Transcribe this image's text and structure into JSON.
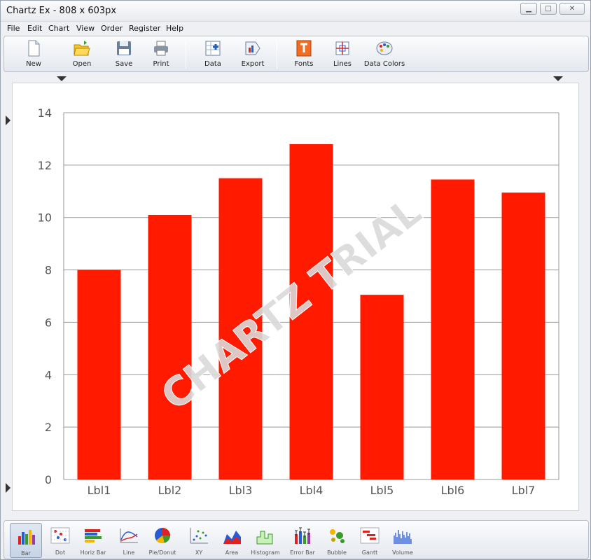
{
  "window": {
    "title": "Chartz Ex - 808 x 603px"
  },
  "menu": [
    "File",
    "Edit",
    "Chart",
    "View",
    "Order",
    "Register",
    "Help"
  ],
  "toolbar": [
    {
      "label": "New",
      "icon": "new-file-icon"
    },
    {
      "label": "Open",
      "icon": "open-folder-icon"
    },
    {
      "label": "Save",
      "icon": "floppy-disk-icon"
    },
    {
      "label": "Print",
      "icon": "printer-icon"
    },
    {
      "label": "Data",
      "icon": "data-table-icon"
    },
    {
      "label": "Export",
      "icon": "export-chart-icon"
    },
    {
      "label": "Fonts",
      "icon": "fonts-icon"
    },
    {
      "label": "Lines",
      "icon": "lines-icon"
    },
    {
      "label": "Data Colors",
      "icon": "palette-icon"
    }
  ],
  "watermark": "CHARTZ TRIAL",
  "colors": {
    "bar": "#ff1a00",
    "grid": "#999999",
    "watermark": "#d9d9d9"
  },
  "chart_data": {
    "type": "bar",
    "categories": [
      "Lbl1",
      "Lbl2",
      "Lbl3",
      "Lbl4",
      "Lbl5",
      "Lbl6",
      "Lbl7"
    ],
    "values": [
      8.0,
      10.1,
      11.5,
      12.8,
      7.05,
      11.45,
      10.95
    ],
    "ylim": [
      0,
      14
    ],
    "yticks": [
      0,
      2,
      4,
      6,
      8,
      10,
      12,
      14
    ],
    "grid": true,
    "title": "",
    "xlabel": "",
    "ylabel": ""
  },
  "chart_types": [
    {
      "label": "Bar",
      "icon": "bar-chart-icon",
      "selected": true
    },
    {
      "label": "Dot",
      "icon": "dot-chart-icon"
    },
    {
      "label": "Horiz Bar",
      "icon": "horizontal-bar-chart-icon"
    },
    {
      "label": "Line",
      "icon": "line-chart-icon"
    },
    {
      "label": "Pie/Donut",
      "icon": "pie-chart-icon"
    },
    {
      "label": "XY",
      "icon": "xy-scatter-icon"
    },
    {
      "label": "Area",
      "icon": "area-chart-icon"
    },
    {
      "label": "Histogram",
      "icon": "histogram-icon"
    },
    {
      "label": "Error Bar",
      "icon": "error-bar-chart-icon"
    },
    {
      "label": "Bubble",
      "icon": "bubble-chart-icon"
    },
    {
      "label": "Gantt",
      "icon": "gantt-chart-icon"
    },
    {
      "label": "Volume",
      "icon": "volume-chart-icon"
    }
  ]
}
